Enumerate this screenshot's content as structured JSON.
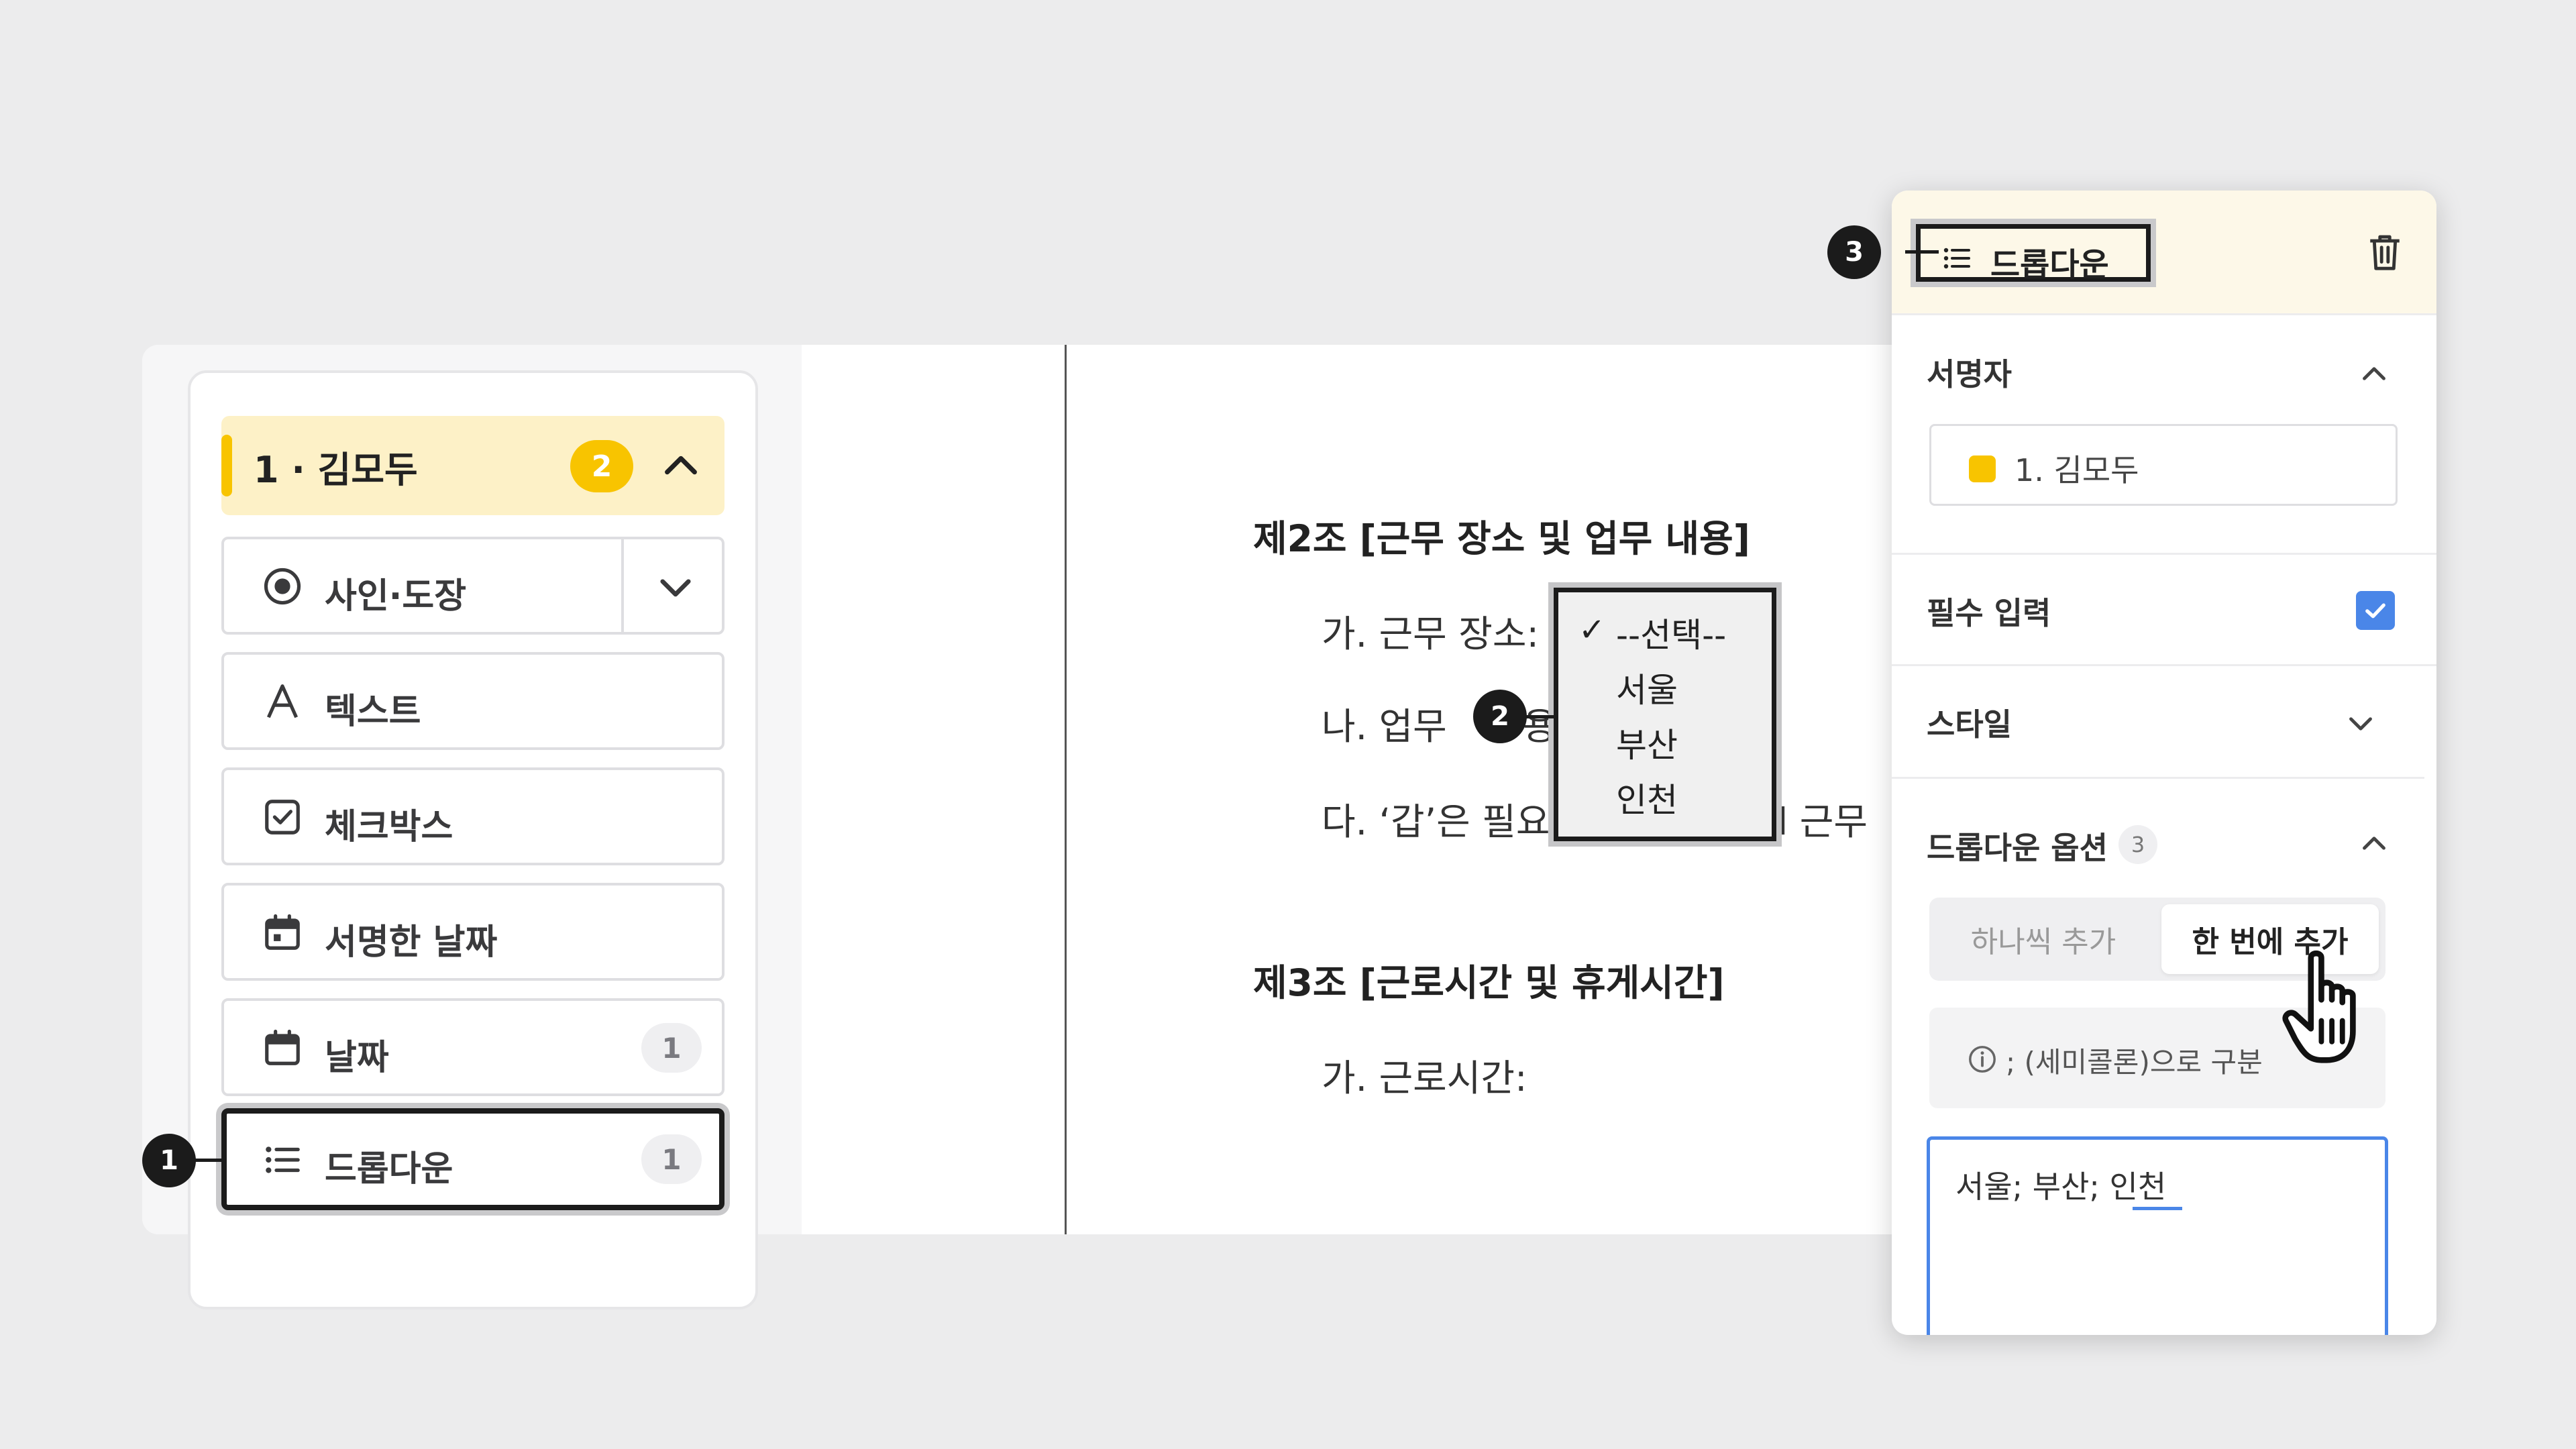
{
  "sidebar": {
    "signer": {
      "name": "1 · 김모두",
      "count": "2"
    },
    "fields": [
      {
        "label": "사인·도장",
        "icon": "radio-target-icon"
      },
      {
        "label": "텍스트",
        "icon": "text-a-icon"
      },
      {
        "label": "체크박스",
        "icon": "checkbox-icon"
      },
      {
        "label": "서명한 날짜",
        "icon": "calendar-filled-icon"
      },
      {
        "label": "날짜",
        "icon": "calendar-icon",
        "count": "1"
      },
      {
        "label": "드롭다운",
        "icon": "list-icon",
        "count": "1"
      }
    ]
  },
  "document": {
    "article2_heading": "제2조 [근무 장소 및 업무 내용]",
    "item_ga": "가. 근무 장소:",
    "item_na_prefix": "나. 업무",
    "item_na_suffix": "용:",
    "item_da_prefix": "다. ‘갑’은 필요",
    "item_da_suffix": "l 근무",
    "article3_heading": "제3조 [근로시간 및 휴게시간]",
    "item3_ga": "가. 근로시간:"
  },
  "dropdown_popup": {
    "selected_mark": "✓",
    "options": [
      "--선택--",
      "서울",
      "부산",
      "인천"
    ]
  },
  "markers": [
    "1",
    "2",
    "3"
  ],
  "panel": {
    "title": "드롭다운",
    "signer_label": "서명자",
    "signer_value": "1. 김모두",
    "required_label": "필수 입력",
    "required_checked": true,
    "style_label": "스타일",
    "options_label": "드롭다운 옵션",
    "options_count": "3",
    "segment_left": "하나씩 추가",
    "segment_right": "한 번에 추가",
    "hint": "; (세미콜론)으로 구분",
    "textarea_value": "서울; 부산; 인천"
  },
  "colors": {
    "accent_yellow": "#f8c400",
    "signer_bg": "#fdf1c7",
    "check_blue": "#4a86e8",
    "marker_dark": "#1b1b1b"
  }
}
